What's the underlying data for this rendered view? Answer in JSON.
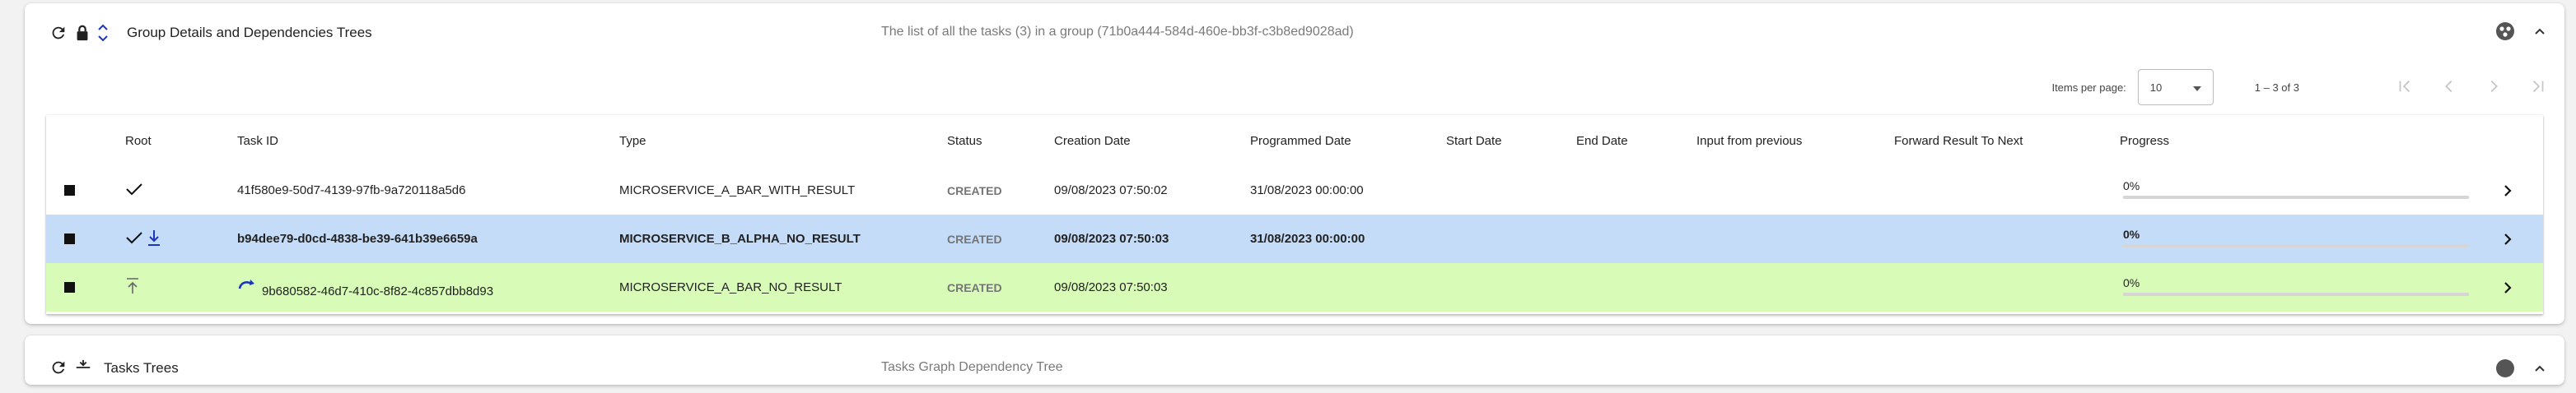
{
  "group_panel": {
    "title": "Group Details and Dependencies Trees",
    "description": "The list of all the tasks (3) in a group (71b0a444-584d-460e-bb3f-c3b8ed9028ad)",
    "icons": [
      "refresh-icon",
      "lock-icon",
      "unfold-icon",
      "status-circle-icon",
      "chevron-up-icon"
    ]
  },
  "paginator": {
    "items_per_page_label": "Items per page:",
    "items_per_page_value": "10",
    "range_label": "1 – 3 of 3"
  },
  "table": {
    "columns": [
      "Root",
      "Task ID",
      "Type",
      "Status",
      "Creation Date",
      "Programmed Date",
      "Start Date",
      "End Date",
      "Input from previous",
      "Forward Result To Next",
      "Progress"
    ],
    "rows": [
      {
        "task_id": "41f580e9-50d7-4139-97fb-9a720118a5d6",
        "type": "MICROSERVICE_A_BAR_WITH_RESULT",
        "status": "CREATED",
        "creation_date": "09/08/2023 07:50:02",
        "programmed_date": "31/08/2023 00:00:00",
        "start_date": "",
        "end_date": "",
        "input_from_previous": "",
        "forward_result": "",
        "progress_label": "0%",
        "progress_fraction": 0,
        "root_icons": [
          "check-icon"
        ],
        "highlight": "none"
      },
      {
        "task_id": "b94dee79-d0cd-4838-be39-641b39e6659a",
        "type": "MICROSERVICE_B_ALPHA_NO_RESULT",
        "status": "CREATED",
        "creation_date": "09/08/2023 07:50:03",
        "programmed_date": "31/08/2023 00:00:00",
        "start_date": "",
        "end_date": "",
        "input_from_previous": "",
        "forward_result": "",
        "progress_label": "0%",
        "progress_fraction": 0,
        "root_icons": [
          "check-icon",
          "arrow-down-bar-icon"
        ],
        "highlight": "blue"
      },
      {
        "task_id": "9b680582-46d7-410c-8f82-4c857dbb8d93",
        "type": "MICROSERVICE_A_BAR_NO_RESULT",
        "status": "CREATED",
        "creation_date": "09/08/2023 07:50:03",
        "programmed_date": "",
        "start_date": "",
        "end_date": "",
        "input_from_previous": "",
        "forward_result": "",
        "progress_label": "0%",
        "progress_fraction": 0,
        "root_icons": [
          "arrow-up-bar-icon"
        ],
        "task_id_icon": "redo-arrow-icon",
        "highlight": "green"
      }
    ]
  },
  "tasks_panel": {
    "title": "Tasks Trees",
    "description": "Tasks Graph Dependency Tree"
  },
  "colors": {
    "selected_row": "#c4dcf7",
    "dependent_row": "#d8fbb8",
    "status_text": "#757575",
    "accent_blue": "#1a35c0"
  }
}
